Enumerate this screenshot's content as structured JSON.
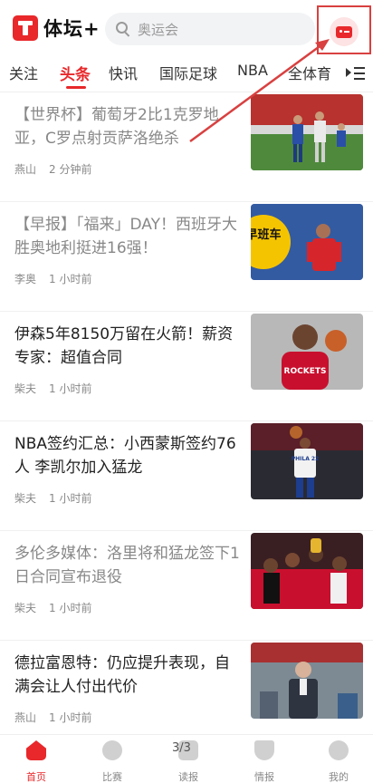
{
  "header": {
    "app_name": "体坛+",
    "search_placeholder": "奥运会",
    "message_icon": "message-icon",
    "highlight_color": "#d94040"
  },
  "tabs": [
    {
      "label": "关注",
      "active": false
    },
    {
      "label": "头条",
      "active": true
    },
    {
      "label": "快讯",
      "active": false
    },
    {
      "label": "国际足球",
      "active": false
    },
    {
      "label": "NBA",
      "active": false
    },
    {
      "label": "全体育",
      "active": false
    }
  ],
  "articles": [
    {
      "title": "【世界杯】葡萄牙2比1克罗地亚，C罗点射贡萨洛绝杀",
      "author": "燕山",
      "time": "2 分钟前",
      "read": true
    },
    {
      "title": "【早报】「福来」DAY！西班牙大胜奥地利挺进16强！",
      "author": "李奥",
      "time": "1 小时前",
      "read": true,
      "thumb_badge": "早班车"
    },
    {
      "title": "伊森5年8150万留在火箭！薪资专家：超值合同",
      "author": "柴夫",
      "time": "1 小时前",
      "read": false,
      "jersey_text": "ROCKETS"
    },
    {
      "title": "NBA签约汇总：小西蒙斯签约76人 李凯尔加入猛龙",
      "author": "柴夫",
      "time": "1 小时前",
      "read": false,
      "jersey_text": "PHILA 22"
    },
    {
      "title": "多伦多媒体：洛里将和猛龙签下1日合同宣布退役",
      "author": "柴夫",
      "time": "1 小时前",
      "read": true
    },
    {
      "title": "德拉富恩特：仍应提升表现，自满会让人付出代价",
      "author": "燕山",
      "time": "1 小时前",
      "read": false
    }
  ],
  "bottom_nav": [
    {
      "label": "首页",
      "active": true
    },
    {
      "label": "比赛",
      "active": false
    },
    {
      "label": "读报",
      "active": false
    },
    {
      "label": "情报",
      "active": false
    },
    {
      "label": "我的",
      "active": false
    }
  ],
  "page_indicator": "3/3",
  "colors": {
    "accent": "#e8282b",
    "muted": "#888888"
  }
}
